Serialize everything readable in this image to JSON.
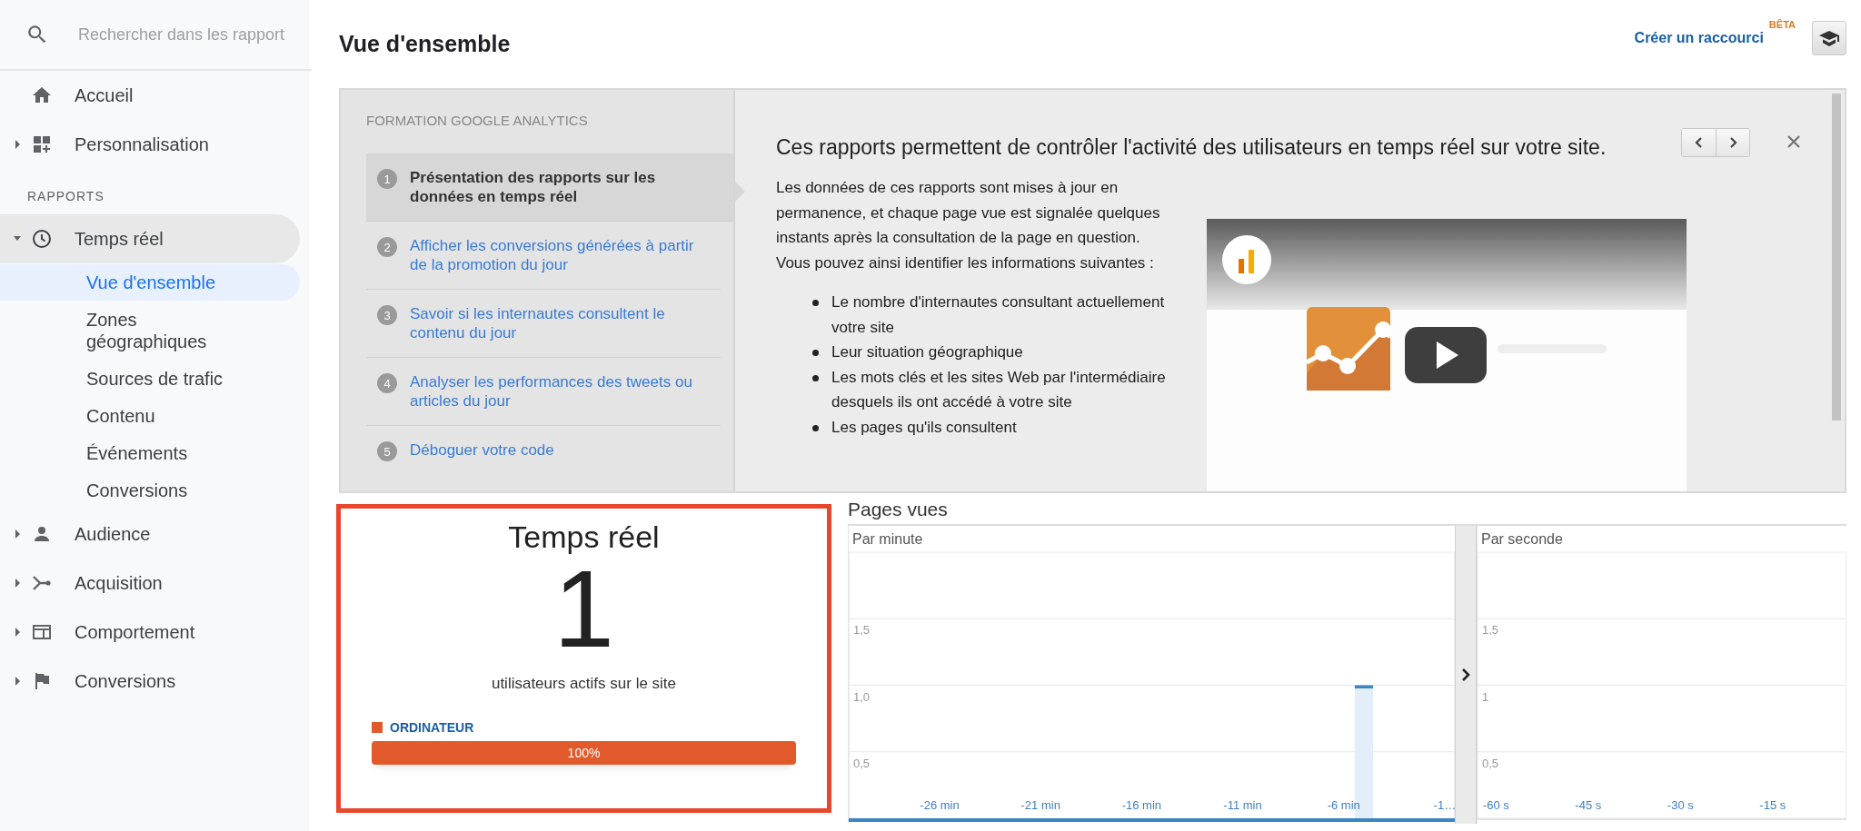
{
  "header": {
    "title": "Vue d'ensemble",
    "shortcut_link": "Créer un raccourci",
    "shortcut_badge": "BÊTA"
  },
  "sidebar": {
    "search": {
      "placeholder": "Rechercher dans les rapport"
    },
    "items": [
      {
        "label": "Accueil",
        "selected": false
      },
      {
        "label": "Personnalisation",
        "expanded": false,
        "selected": false
      }
    ],
    "section_label": "RAPPORTS",
    "report_items": [
      {
        "label": "Temps réel",
        "expanded": true,
        "selected": true,
        "children": [
          {
            "label": "Vue d'ensemble",
            "selected": true
          },
          {
            "label": "Zones géographiques",
            "selected": false
          },
          {
            "label": "Sources de trafic",
            "selected": false
          },
          {
            "label": "Contenu",
            "selected": false
          },
          {
            "label": "Événements",
            "selected": false
          },
          {
            "label": "Conversions",
            "selected": false
          }
        ]
      },
      {
        "label": "Audience",
        "expanded": false,
        "selected": false
      },
      {
        "label": "Acquisition",
        "expanded": false,
        "selected": false
      },
      {
        "label": "Comportement",
        "expanded": false,
        "selected": false
      },
      {
        "label": "Conversions",
        "expanded": false,
        "selected": false
      }
    ]
  },
  "training": {
    "label": "FORMATION GOOGLE ANALYTICS",
    "steps": [
      {
        "number": "1",
        "label": "Présentation des rapports sur les données en temps réel",
        "selected": true
      },
      {
        "number": "2",
        "label": "Afficher les conversions générées à partir de la promotion du jour",
        "selected": false
      },
      {
        "number": "3",
        "label": "Savoir si les internautes consultent le contenu du jour",
        "selected": false
      },
      {
        "number": "4",
        "label": "Analyser les performances des tweets ou articles du jour",
        "selected": false
      },
      {
        "number": "5",
        "label": "Déboguer votre code",
        "selected": false
      }
    ],
    "heading": "Ces rapports permettent de contrôler l'activité des utilisateurs en temps réel sur votre site.",
    "paragraph": "Les données de ces rapports sont mises à jour en permanence, et chaque page vue est signalée quelques instants après la consultation de la page en question. Vous pouvez ainsi identifier les informations suivantes :",
    "bullets": [
      "Le nombre d'internautes consultant actuellement votre site",
      "Leur situation géographique",
      "Les mots clés et les sites Web par l'intermédiaire desquels ils ont accédé à votre site",
      "Les pages qu'ils consultent"
    ]
  },
  "realtime": {
    "title": "Temps réel",
    "count": "1",
    "caption": "utilisateurs actifs sur le site",
    "devices": [
      {
        "label": "ORDINATEUR",
        "color": "#e05a2b",
        "level": 1,
        "reading": "100%"
      }
    ]
  },
  "pageviews": {
    "title": "Pages vues",
    "per_minute": {
      "subtitle": "Par minute",
      "chart_data": {
        "type": "bar",
        "x": [
          -30,
          -29,
          -28,
          -27,
          -26,
          -25,
          -24,
          -23,
          -22,
          -21,
          -20,
          -19,
          -18,
          -17,
          -16,
          -15,
          -14,
          -13,
          -12,
          -11,
          -10,
          -9,
          -8,
          -7,
          -6,
          -5,
          -4,
          -3,
          -2,
          -1
        ],
        "values": [
          0,
          0,
          0,
          0,
          0,
          0,
          0,
          0,
          0,
          0,
          0,
          0,
          0,
          0,
          0,
          0,
          0,
          0,
          0,
          0,
          0,
          0,
          0,
          0,
          0,
          1,
          0,
          0,
          0,
          0
        ],
        "grid": true,
        "xlim": [
          -30.5,
          -0.5
        ],
        "ylim": [
          0,
          2
        ],
        "yticks": [
          {
            "value": 0.5,
            "label": "0,5"
          },
          {
            "value": 1,
            "label": "1,0"
          },
          {
            "value": 1.5,
            "label": "1,5"
          }
        ],
        "xticks": [
          {
            "value": -26,
            "label": "-26 min"
          },
          {
            "value": -21,
            "label": "-21 min"
          },
          {
            "value": -16,
            "label": "-16 min"
          },
          {
            "value": -11,
            "label": "-11 min"
          },
          {
            "value": -6,
            "label": "-6 min"
          },
          {
            "value": -1,
            "label": "-1…"
          }
        ]
      }
    },
    "per_second": {
      "subtitle": "Par seconde",
      "chart_data": {
        "type": "bar",
        "grid": true,
        "xlim": [
          -63,
          -3
        ],
        "ylim": [
          0,
          2
        ],
        "yticks": [
          {
            "value": 0.5,
            "label": "0,5"
          },
          {
            "value": 1,
            "label": "1"
          },
          {
            "value": 1.5,
            "label": "1,5"
          }
        ],
        "xticks": [
          {
            "value": -60,
            "label": "-60 s"
          },
          {
            "value": -45,
            "label": "-45 s"
          },
          {
            "value": -30,
            "label": "-30 s"
          },
          {
            "value": -15,
            "label": "-15 s"
          }
        ]
      }
    }
  }
}
